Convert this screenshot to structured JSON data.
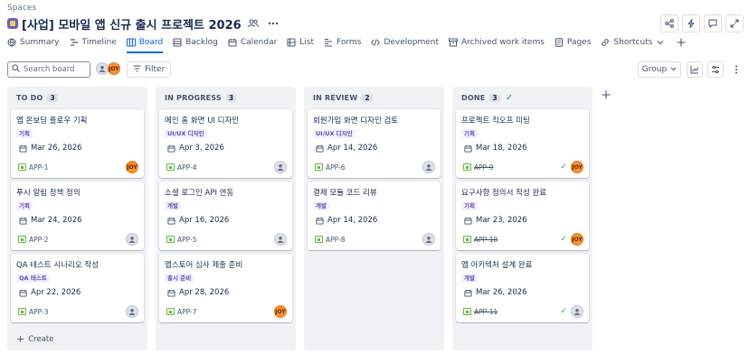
{
  "breadcrumb": "Spaces",
  "project": {
    "title": "[사업] 모바일 앱 신규 출시 프로젝트 2026"
  },
  "tabs": [
    {
      "label": "Summary",
      "icon": "globe-icon"
    },
    {
      "label": "Timeline",
      "icon": "timeline-icon"
    },
    {
      "label": "Board",
      "icon": "board-icon",
      "active": true
    },
    {
      "label": "Backlog",
      "icon": "backlog-icon"
    },
    {
      "label": "Calendar",
      "icon": "calendar-icon"
    },
    {
      "label": "List",
      "icon": "list-icon"
    },
    {
      "label": "Forms",
      "icon": "forms-icon"
    },
    {
      "label": "Development",
      "icon": "code-icon"
    },
    {
      "label": "Archived work items",
      "icon": "archive-icon"
    },
    {
      "label": "Pages",
      "icon": "pages-icon"
    },
    {
      "label": "Shortcuts",
      "icon": "link-icon"
    }
  ],
  "toolbar": {
    "search_placeholder": "Search board",
    "filter_label": "Filter",
    "group_label": "Group",
    "avatar_label": "JOY"
  },
  "columns": [
    {
      "title": "TO DO",
      "count": "3",
      "cards": [
        {
          "title": "앱 온보딩 플로우 기획",
          "label": "기획",
          "date": "Mar 26, 2026",
          "key": "APP-1",
          "assignee": "JOY"
        },
        {
          "title": "푸시 알림 정책 정의",
          "label": "기획",
          "date": "Mar 24, 2026",
          "key": "APP-2",
          "assignee": ""
        },
        {
          "title": "QA 테스트 시나리오 작성",
          "label": "QA 테스트",
          "date": "Apr 22, 2026",
          "key": "APP-3",
          "assignee": ""
        }
      ],
      "create_label": "Create"
    },
    {
      "title": "IN PROGRESS",
      "count": "3",
      "cards": [
        {
          "title": "메인 홈 화면 UI 디자인",
          "label": "UI/UX 디자인",
          "date": "Apr 3, 2026",
          "key": "APP-4",
          "assignee": ""
        },
        {
          "title": "소셜 로그인 API 연동",
          "label": "개발",
          "date": "Apr 16, 2026",
          "key": "APP-5",
          "assignee": ""
        },
        {
          "title": "앱스토어 심사 제출 준비",
          "label": "출시 준비",
          "date": "Apr 28, 2026",
          "key": "APP-7",
          "assignee": "JOY"
        }
      ]
    },
    {
      "title": "IN REVIEW",
      "count": "2",
      "cards": [
        {
          "title": "회원가입 화면 디자인 검토",
          "label": "UI/UX 디자인",
          "date": "Apr 14, 2026",
          "key": "APP-6",
          "assignee": ""
        },
        {
          "title": "결제 모듈 코드 리뷰",
          "label": "개발",
          "date": "Apr 14, 2026",
          "key": "APP-8",
          "assignee": ""
        }
      ]
    },
    {
      "title": "DONE",
      "count": "3",
      "cards": [
        {
          "title": "프로젝트 킥오프 미팅",
          "label": "기획",
          "date": "Mar 18, 2026",
          "key": "APP-9",
          "assignee": "JOY",
          "done": true
        },
        {
          "title": "요구사항 정의서 작성 완료",
          "label": "기획",
          "date": "Mar 23, 2026",
          "key": "APP-10",
          "assignee": "JOY",
          "done": true
        },
        {
          "title": "앱 아키텍처 설계 완료",
          "label": "개발",
          "date": "Mar 26, 2026",
          "key": "APP-11",
          "assignee": "",
          "done": true
        }
      ]
    }
  ],
  "colors": {
    "accent": "#0c66e4",
    "label_bg": "#f3f0ff",
    "label_fg": "#5e4db2",
    "done_check": "#22a06b",
    "avatar_joy": "#f79232"
  }
}
